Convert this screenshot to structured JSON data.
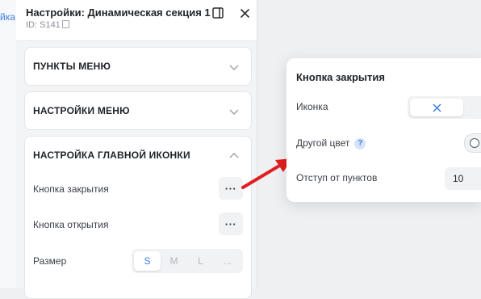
{
  "background": {
    "link_fragment": "йка"
  },
  "panel": {
    "title": "Настройки: Динамическая секция 1",
    "id_label": "ID: S141",
    "sections": [
      {
        "title": "ПУНКТЫ МЕНЮ",
        "expanded": false
      },
      {
        "title": "НАСТРОЙКИ МЕНЮ",
        "expanded": false
      },
      {
        "title": "НАСТРОЙКА ГЛАВНОЙ ИКОНКИ",
        "expanded": true
      }
    ],
    "main_icon": {
      "close_button_label": "Кнопка закрытия",
      "open_button_label": "Кнопка открытия",
      "dots": "···",
      "size_label": "Размер",
      "size_options": [
        "S",
        "M",
        "L",
        "..."
      ],
      "size_selected": "S"
    }
  },
  "popup": {
    "title": "Кнопка закрытия",
    "icon_label": "Иконка",
    "other_color_label": "Другой цвет",
    "help_mark": "?",
    "other_color_enabled": false,
    "offset_label": "Отступ от пунктов",
    "offset_value": "10"
  },
  "colors": {
    "accent": "#3b7ddd",
    "arrow": "#e02020",
    "panel_bg": "#f3f4f6"
  }
}
